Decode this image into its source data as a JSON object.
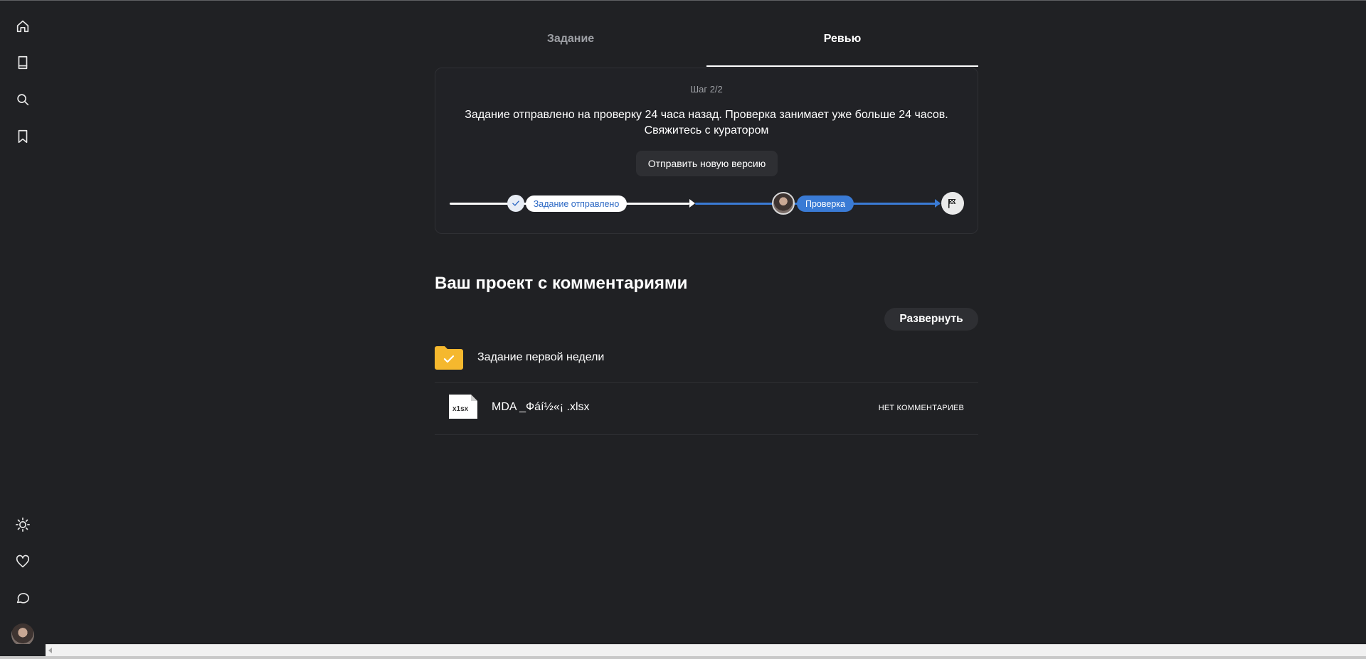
{
  "sidebar": {
    "top_icons": [
      "home-icon",
      "book-icon",
      "search-icon",
      "bookmark-icon"
    ],
    "bottom_icons": [
      "sun-icon",
      "heart-icon",
      "chat-icon"
    ]
  },
  "tabs": {
    "task": "Задание",
    "review": "Ревью",
    "active": "review"
  },
  "review_card": {
    "step": "Шаг 2/2",
    "status_line1": "Задание отправлено на проверку 24 часа назад. Проверка занимает уже больше 24 часов.",
    "status_line2": "Свяжитесь с куратором",
    "new_version_button": "Отправить новую версию",
    "progress": {
      "stage_sent": "Задание отправлено",
      "stage_review": "Проверка"
    }
  },
  "project": {
    "title": "Ваш проект с комментариями",
    "expand_button": "Развернуть",
    "folder_name": "Задание первой недели",
    "files": [
      {
        "icon_label": "x1sx",
        "name": "MDA _Фáí½«¡ .xlsx",
        "comments": "НЕТ КОММЕНТАРИЕВ"
      }
    ]
  },
  "colors": {
    "background": "#202124",
    "accent_blue": "#3a7bd5",
    "folder_yellow": "#f5b82e"
  }
}
